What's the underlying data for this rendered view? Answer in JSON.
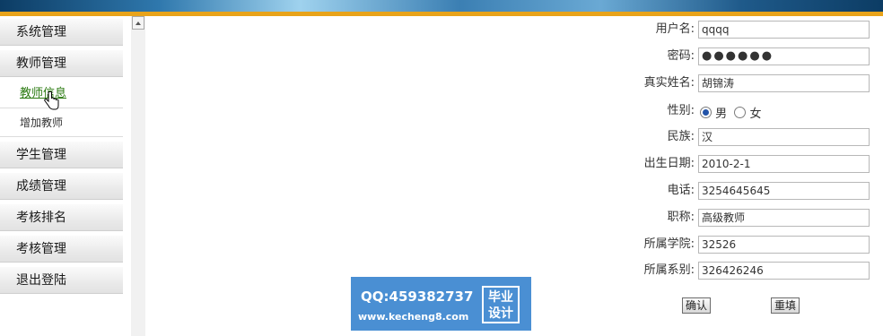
{
  "sidebar": {
    "items": [
      {
        "label": "系统管理"
      },
      {
        "label": "教师管理"
      },
      {
        "label": "教师信息"
      },
      {
        "label": "增加教师"
      },
      {
        "label": "学生管理"
      },
      {
        "label": "成绩管理"
      },
      {
        "label": "考核排名"
      },
      {
        "label": "考核管理"
      },
      {
        "label": "退出登陆"
      }
    ]
  },
  "form": {
    "username": {
      "label": "用户名:",
      "value": "qqqq"
    },
    "password": {
      "label": "密码:",
      "value": "●●●●●●"
    },
    "realname": {
      "label": "真实姓名:",
      "value": "胡锦涛"
    },
    "gender": {
      "label": "性别:",
      "options": [
        "男",
        "女"
      ],
      "selected": "男"
    },
    "ethnicity": {
      "label": "民族:",
      "value": "汉"
    },
    "birthdate": {
      "label": "出生日期:",
      "value": "2010-2-1"
    },
    "phone": {
      "label": "电话:",
      "value": "3254645645"
    },
    "title": {
      "label": "职称:",
      "value": "高级教师"
    },
    "college": {
      "label": "所属学院:",
      "value": "32526"
    },
    "department": {
      "label": "所属系别:",
      "value": "326426246"
    },
    "confirm_label": "确认",
    "reset_label": "重填"
  },
  "watermark": {
    "qq": "QQ:459382737",
    "url": "www.kecheng8.com",
    "badge_line1": "毕业",
    "badge_line2": "设计"
  },
  "colors": {
    "accent": "#e8a31a",
    "watermark_bg": "#4a8fd3",
    "active_link": "#2a7a10"
  }
}
